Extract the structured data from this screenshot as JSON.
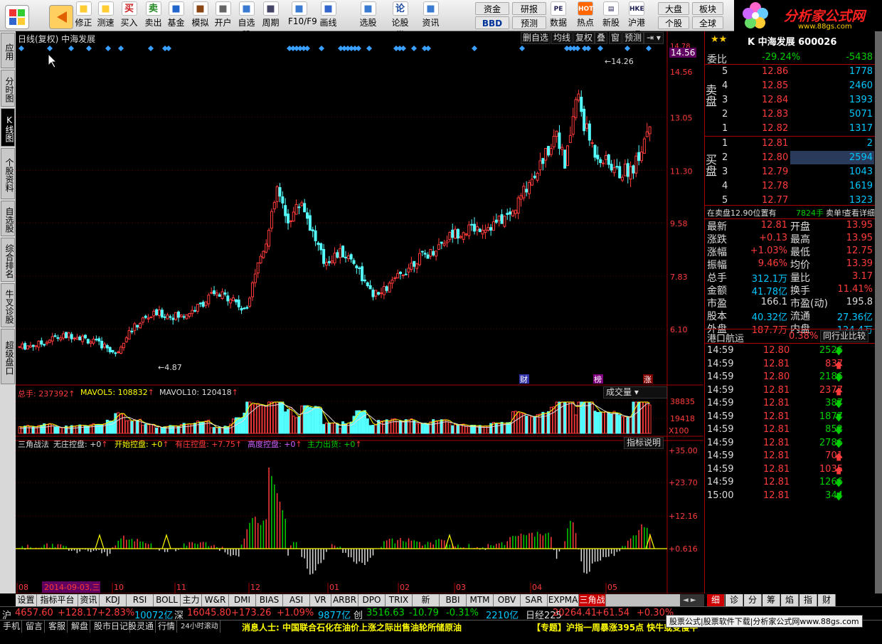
{
  "toolbar": {
    "left": [
      {
        "label": "",
        "icon": "menu-icon"
      },
      {
        "label": "",
        "icon": "back-icon"
      },
      {
        "label": "修正",
        "icon": "refresh-icon"
      },
      {
        "label": "测速",
        "icon": "speed-icon"
      },
      {
        "label": "买入",
        "icon": "buy-icon",
        "mark": "买"
      },
      {
        "label": "卖出",
        "icon": "sell-icon",
        "mark": "卖"
      },
      {
        "label": "基金",
        "icon": "fund-icon"
      },
      {
        "label": "模拟",
        "icon": "hammer-icon"
      },
      {
        "label": "开户",
        "icon": "lock-icon"
      },
      {
        "label": "自选股",
        "icon": "star-icon"
      },
      {
        "label": "周期",
        "icon": "clock-icon"
      },
      {
        "label": "F10/F9",
        "icon": "f10-icon"
      },
      {
        "label": "画线",
        "icon": "pen-icon"
      },
      {
        "label": "选股",
        "icon": "select-icon"
      },
      {
        "label": "论股堂",
        "icon": "forum-icon",
        "mark": "论"
      },
      {
        "label": "资讯",
        "icon": "news-icon"
      }
    ],
    "small": [
      [
        "资金",
        "研报"
      ],
      [
        "BBD",
        "预测"
      ]
    ],
    "right": [
      {
        "label": "数据",
        "icon": "pe-icon",
        "mark": "PE"
      },
      {
        "label": "热点",
        "icon": "hot-icon",
        "mark": "HOT"
      },
      {
        "label": "新股",
        "icon": "newstock-icon"
      },
      {
        "label": "沪港通",
        "icon": "hk-icon",
        "mark": "HKE"
      }
    ],
    "pairs": [
      [
        "大盘",
        "个股"
      ],
      [
        "板块",
        "全球"
      ]
    ]
  },
  "logo": {
    "title": "分析家公式网",
    "url": "www.88gs.com"
  },
  "vtabs": [
    "应用",
    "分时图",
    "K线图",
    "个股资料",
    "自选股",
    "综合排名",
    "牛叉诊股",
    "超级盘口"
  ],
  "chart": {
    "title": "日线(复权)  中海发展",
    "buttons": [
      "删自选",
      "均线",
      "复权",
      "叠",
      "窗",
      "预测"
    ],
    "price_max": "14.56",
    "price_top": "14.78",
    "hi": "14.26",
    "lo": "4.87",
    "markers": [
      "财",
      "榜",
      "涨"
    ]
  },
  "chart_data": {
    "type": "candlestick",
    "y_ticks": [
      14.56,
      13.05,
      11.3,
      9.58,
      7.83,
      6.1
    ],
    "volume_ticks": [
      38835,
      19418
    ],
    "volume_unit": "X100",
    "indicator_ticks": [
      "+35.00",
      "+23.70",
      "+12.16",
      "+0.616"
    ],
    "x_ticks": [
      "08",
      "2014-09-03,三",
      "10",
      "11",
      "12",
      "01",
      "02",
      "03",
      "04",
      "05"
    ],
    "high": 14.26,
    "low": 4.87
  },
  "volume": {
    "label": "总手: 237392",
    "ma5": "MAVOL5: 108832",
    "ma10": "MAVOL10: 120418",
    "name": "成交量"
  },
  "indicator": {
    "name": "三角战法",
    "items": [
      {
        "t": "无庄控盘: +0",
        "c": "#ddd"
      },
      {
        "t": "开始控盘: +0",
        "c": "#ffff00"
      },
      {
        "t": "有庄控盘: +7.75",
        "c": "#ff3b3b"
      },
      {
        "t": "高度控盘: +0",
        "c": "#d060ff"
      },
      {
        "t": "主力出货: +0",
        "c": "#00d000"
      }
    ],
    "explain": "指标说明"
  },
  "btabs": [
    "设置",
    "指标平台",
    "资讯",
    "KDJ",
    "RSI",
    "BOLL",
    "主力",
    "W&R",
    "DMI",
    "BIAS",
    "ASI",
    "VR",
    "ARBR",
    "DPO",
    "TRIX",
    "新DMA",
    "BBI",
    "MTM",
    "OBV",
    "SAR",
    "EXPMA",
    "三角战法"
  ],
  "rtabs": [
    "细",
    "诊",
    "分",
    "筹",
    "焰",
    "指",
    "财"
  ],
  "quote": {
    "header": [
      "K 中海发展 600026"
    ],
    "weibi": "委比",
    "weibi_val": "-29.24%",
    "weibi_diff": "-5438",
    "sell": [
      [
        "5",
        "12.86",
        "1778"
      ],
      [
        "4",
        "12.85",
        "2460"
      ],
      [
        "3",
        "12.84",
        "1393"
      ],
      [
        "2",
        "12.83",
        "5071"
      ],
      [
        "1",
        "12.82",
        "1317"
      ]
    ],
    "buy": [
      [
        "1",
        "12.81",
        "2"
      ],
      [
        "2",
        "12.80",
        "2594"
      ],
      [
        "3",
        "12.79",
        "1043"
      ],
      [
        "4",
        "12.78",
        "1619"
      ],
      [
        "5",
        "12.77",
        "1323"
      ]
    ],
    "sell_label": "卖盘",
    "buy_label": "买盘",
    "notice": [
      "在卖盘12.90位置有",
      "7824手",
      "卖单!",
      "查看详细"
    ],
    "stats": [
      [
        "最新",
        "12.81",
        "开盘",
        "13.95"
      ],
      [
        "涨跌",
        "+0.13",
        "最高",
        "13.95"
      ],
      [
        "涨幅",
        "+1.03%",
        "最低",
        "12.75"
      ],
      [
        "振幅",
        "9.46%",
        "均价",
        "13.39"
      ],
      [
        "总手",
        "312.1万",
        "量比",
        "3.17"
      ],
      [
        "金额",
        "41.78亿",
        "换手",
        "11.41%"
      ],
      [
        "市盈",
        "166.1",
        "市盈(动)",
        "195.8"
      ],
      [
        "股本",
        "40.32亿",
        "流通",
        "27.36亿"
      ],
      [
        "外盘",
        "187.7万",
        "内盘",
        "124.4万"
      ]
    ],
    "sector": "港口航运",
    "sector_pct": "0.38%",
    "compare": "同行业比较",
    "ticks": [
      [
        "14:59",
        "12.80",
        "2526",
        "down"
      ],
      [
        "14:59",
        "12.81",
        "837",
        "up"
      ],
      [
        "14:59",
        "12.80",
        "2186",
        "down"
      ],
      [
        "14:59",
        "12.81",
        "2377",
        "up"
      ],
      [
        "14:59",
        "12.81",
        "387",
        "down"
      ],
      [
        "14:59",
        "12.81",
        "1877",
        "down"
      ],
      [
        "14:59",
        "12.81",
        "852",
        "down"
      ],
      [
        "14:59",
        "12.81",
        "2786",
        "down"
      ],
      [
        "14:59",
        "12.81",
        "701",
        "up"
      ],
      [
        "14:59",
        "12.81",
        "1035",
        "up"
      ],
      [
        "14:59",
        "12.81",
        "1266",
        "down"
      ],
      [
        "15:00",
        "12.81",
        "344",
        "down"
      ]
    ]
  },
  "status": {
    "line1": [
      [
        "沪",
        "#ddd"
      ],
      [
        "4657.60",
        "#ff3b3b"
      ],
      [
        "+128.17",
        "#ff3b3b"
      ],
      [
        "+2.83%",
        "#ff3b3b"
      ],
      [
        "10072亿",
        "#00c8ff"
      ],
      [
        "深",
        "#ddd"
      ],
      [
        "16045.80",
        "#ff3b3b"
      ],
      [
        "+173.26",
        "#ff3b3b"
      ],
      [
        "+1.09%",
        "#ff3b3b"
      ],
      [
        "9877亿",
        "#00c8ff"
      ],
      [
        "创",
        "#ddd"
      ],
      [
        "3516.63",
        "#00d000"
      ],
      [
        "-10.79",
        "#00d000"
      ],
      [
        "-0.31%",
        "#00d000"
      ],
      [
        "2210亿",
        "#00c8ff"
      ],
      [
        "日经225",
        "#ddd"
      ],
      [
        "20264.41",
        "#ff3b3b"
      ],
      [
        "+61.54",
        "#ff3b3b"
      ],
      [
        "+0.30%",
        "#ff3b3b"
      ]
    ],
    "line2_tabs": [
      "手机",
      "留言",
      "客服",
      "解盘",
      "股市日记",
      "股灵通",
      "行情",
      "24小时滚动"
    ],
    "news1": "消息人士: 中国联合石化在油价上涨之际出售油轮所储原油",
    "news2": "【专题】沪指一周暴涨395点 快牛或变慢牛",
    "ad": "股票公式|股票软件下载|分析家公式网www.88gs.com"
  }
}
